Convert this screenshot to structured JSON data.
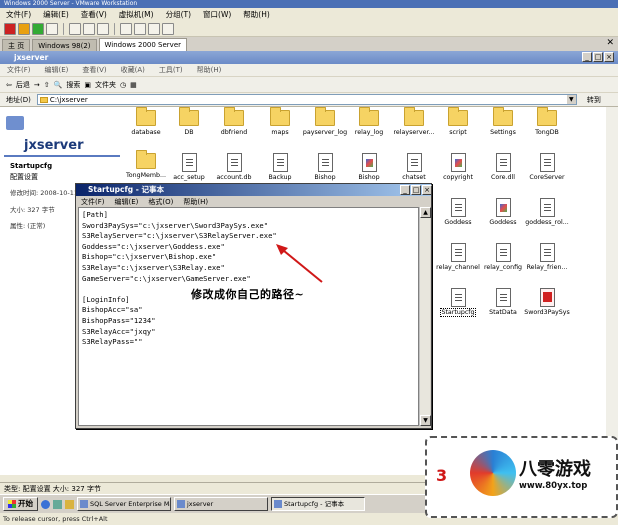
{
  "host": {
    "title": "Windows 2000 Server - VMware Workstation",
    "menu": [
      "文件(F)",
      "编辑(E)",
      "查看(V)",
      "虚拟机(M)",
      "分组(T)",
      "窗口(W)",
      "帮助(H)"
    ],
    "tabs": [
      "主 页",
      "Windows 98(2)",
      "Windows 2000 Server"
    ]
  },
  "explorer": {
    "title": "jxserver",
    "menu": [
      "文件(F)",
      "编辑(E)",
      "查看(V)",
      "收藏(A)",
      "工具(T)",
      "帮助(H)"
    ],
    "back": "后退",
    "search": "搜索",
    "folders": "文件夹",
    "address_label": "地址(D)",
    "address_value": "C:\\jxserver",
    "go": "转到",
    "left_title": "jxserver",
    "selected_name": "Startupcfg",
    "selected_type": "配置设置",
    "modified": "修改时间: 2008-10-11",
    "size": "大小: 327 字节",
    "attrs": "属性: (正常)",
    "items_row1": [
      "database",
      "DB",
      "dbfriend",
      "maps",
      "payserver_log",
      "relay_log",
      "relayserver...",
      "script",
      "Settings",
      "TongDB"
    ],
    "items_row2": [
      "TongMemb...",
      "acc_setup",
      "account.db",
      "Backup",
      "Bishop",
      "Bishop",
      "chatset",
      "copyright",
      "Core.dll",
      "CoreServer"
    ],
    "items_col3": [
      "Goddess",
      "Goddess",
      "goddess_rol..."
    ],
    "items_col4": [
      "relay_channel",
      "relay_config",
      "Relay_frien..."
    ],
    "items_col5": [
      "Startupcfg",
      "StatData",
      "Sword3PaySys"
    ],
    "status": "类型: 配置设置 大小: 327 字节"
  },
  "notepad": {
    "title": "Startupcfg - 记事本",
    "menu": [
      "文件(F)",
      "编辑(E)",
      "格式(O)",
      "帮助(H)"
    ],
    "content": "[Path]\nSword3PaySys=\"c:\\jxserver\\Sword3PaySys.exe\"\nS3RelayServer=\"c:\\jxserver\\S3RelayServer.exe\"\nGoddess=\"c:\\jxserver\\Goddess.exe\"\nBishop=\"c:\\jxserver\\Bishop.exe\"\nS3Relay=\"c:\\jxserver\\S3Relay.exe\"\nGameServer=\"c:\\jxserver\\GameServer.exe\"\n\n[LoginInfo]\nBishopAcc=\"sa\"\nBishopPass=\"1234\"\nS3RelayAcc=\"jxqy\"\nS3RelayPass=\"\""
  },
  "annotation": "修改成你自己的路径~",
  "taskbar": {
    "start": "开始",
    "tasks": [
      "SQL Server Enterprise Ma...",
      "jxserver",
      "Startupcfg - 记事本"
    ],
    "bottom": "To release cursor, press Ctrl+Alt"
  },
  "watermark": {
    "brand": "八零游戏",
    "url": "www.80yx.top",
    "digit": "3"
  }
}
